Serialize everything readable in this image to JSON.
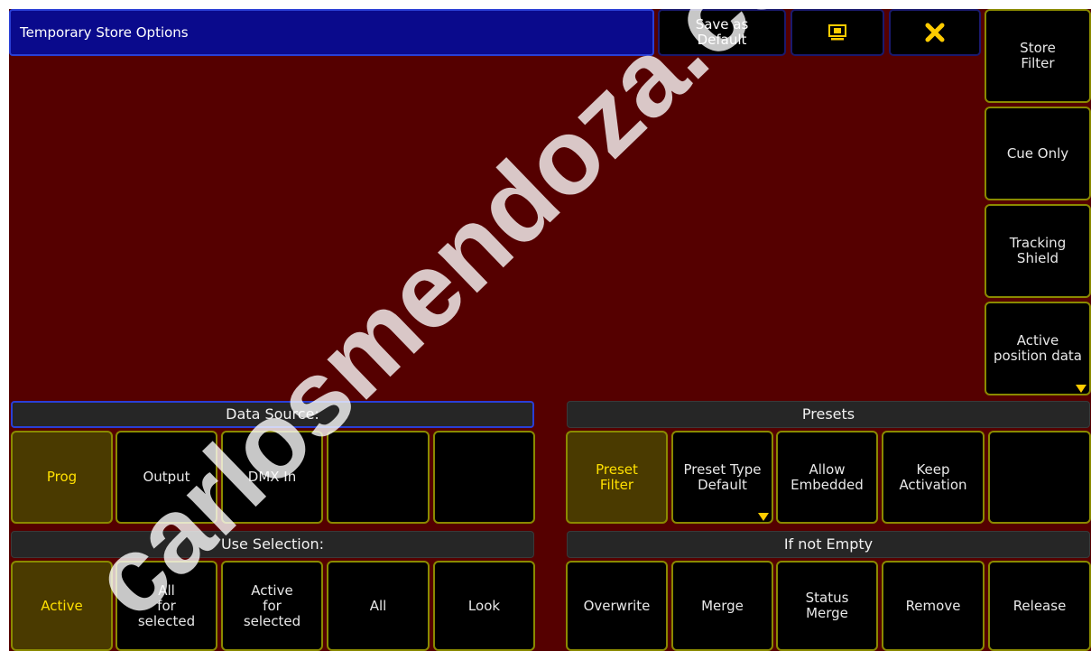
{
  "title": "Temporary Store Options",
  "header_buttons": {
    "save_default": "Save as\nDefault",
    "display_icon": "monitor-icon",
    "close_icon": "close-icon"
  },
  "side_buttons": [
    {
      "label": "Store\nFilter"
    },
    {
      "label": "Cue Only"
    },
    {
      "label": "Tracking\nShield"
    },
    {
      "label": "Active\nposition data"
    }
  ],
  "data_source": {
    "title": "Data Source:",
    "buttons": [
      {
        "label": "Prog",
        "active": true
      },
      {
        "label": "Output",
        "active": false
      },
      {
        "label": "DMX In",
        "active": false
      },
      {
        "label": "",
        "active": false
      },
      {
        "label": "",
        "active": false
      }
    ]
  },
  "presets": {
    "title": "Presets",
    "buttons": [
      {
        "label": "Preset\nFilter",
        "active": true
      },
      {
        "label": "Preset Type\nDefault",
        "active": false
      },
      {
        "label": "Allow\nEmbedded",
        "active": false
      },
      {
        "label": "Keep\nActivation",
        "active": false
      },
      {
        "label": "",
        "active": false
      }
    ]
  },
  "use_selection": {
    "title": "Use Selection:",
    "buttons": [
      {
        "label": "Active",
        "active": true
      },
      {
        "label": "All\nfor\nselected",
        "active": false
      },
      {
        "label": "Active\nfor\nselected",
        "active": false
      },
      {
        "label": "All",
        "active": false
      },
      {
        "label": "Look",
        "active": false
      }
    ]
  },
  "if_not_empty": {
    "title": "If not Empty",
    "buttons": [
      {
        "label": "Overwrite",
        "active": false
      },
      {
        "label": "Merge",
        "active": false
      },
      {
        "label": "Status\nMerge",
        "active": false
      },
      {
        "label": "Remove",
        "active": false
      },
      {
        "label": "Release",
        "active": false
      }
    ]
  },
  "watermark": "carlosmendoza.com",
  "colors": {
    "background": "#550000",
    "title_bar": "#0a0a8c",
    "active_button": "#4a3a00",
    "active_text": "#ffe000",
    "button_border": "#8a8a00"
  }
}
